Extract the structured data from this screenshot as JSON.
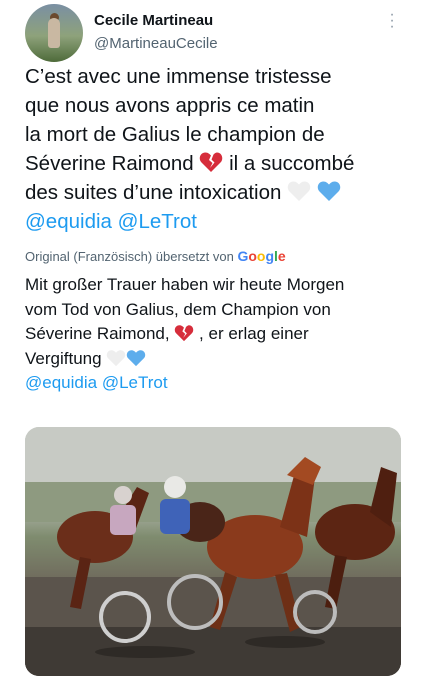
{
  "author": {
    "name": "Cecile Martineau",
    "handle": "@MartineauCecile"
  },
  "tweet": {
    "lines": [
      "C’est avec une immense tristesse",
      "que nous avons appris ce matin",
      "la mort de Galius le champion de",
      "Séverine Raimond",
      "il a succombé",
      "des suites d’une intoxication"
    ],
    "mentions": [
      "@equidia",
      "@LeTrot"
    ]
  },
  "translation_notice": {
    "text": "Original (Französisch) übersetzt von",
    "provider": "Google"
  },
  "translation": {
    "line1": "Mit großer Trauer haben wir heute Morgen",
    "line2": "vom Tod von Galius, dem Champion von",
    "line3a": "Séverine Raimond,",
    "line3b": ", er erlag einer",
    "line4": "Vergiftung",
    "mentions": [
      "@equidia",
      "@LeTrot"
    ]
  },
  "icons": {
    "more": "more-options-icon",
    "broken_heart": "broken-heart-emoji",
    "white_heart": "white-heart-emoji",
    "blue_heart": "blue-heart-emoji"
  },
  "colors": {
    "link": "#1d9bf0",
    "secondary_text": "#536471",
    "broken_heart": "#d62d3b",
    "blue_heart": "#5dadec"
  },
  "media": {
    "subject": "harness-racing-photo"
  }
}
